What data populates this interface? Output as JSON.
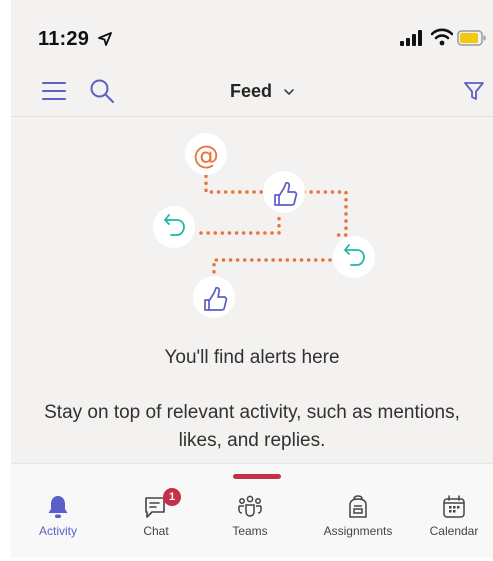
{
  "status_bar": {
    "time": "11:29"
  },
  "header": {
    "title": "Feed",
    "icons": [
      "menu-icon",
      "search-icon",
      "chevron-down-icon",
      "filter-icon"
    ]
  },
  "empty_state": {
    "title": "You'll find alerts here",
    "description": "Stay on top of relevant activity, such as mentions, likes, and replies."
  },
  "tabs": [
    {
      "label": "Activity",
      "icon": "bell-icon",
      "active": true
    },
    {
      "label": "Chat",
      "icon": "chat-icon",
      "badge": "1"
    },
    {
      "label": "Teams",
      "icon": "teams-icon"
    },
    {
      "label": "Assignments",
      "icon": "backpack-icon"
    },
    {
      "label": "Calendar",
      "icon": "calendar-icon"
    }
  ],
  "colors": {
    "accent": "#5b5fc7",
    "badge": "#c4314b",
    "illustration_dots": "#e8743b",
    "mention": "#e8743b",
    "reply": "#1fb8a6",
    "like": "#5b5fc7"
  }
}
